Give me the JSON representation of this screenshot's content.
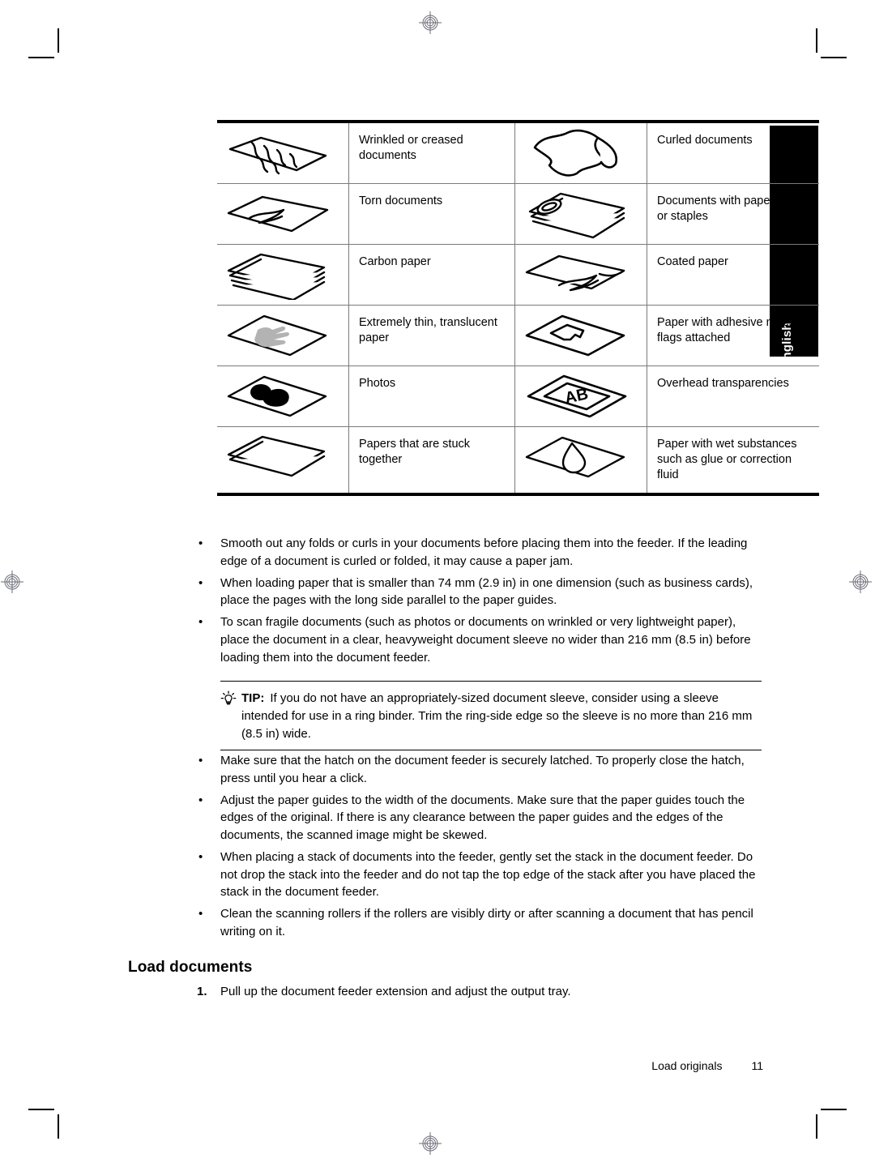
{
  "page": {
    "language_tab": "English",
    "section_heading": "Load documents",
    "footer_title": "Load originals",
    "footer_page_number": "11"
  },
  "media_table": {
    "rows": [
      {
        "left": {
          "icon": "wrinkled-creased-paper-icon",
          "label": "Wrinkled or creased documents"
        },
        "right": {
          "icon": "curled-paper-icon",
          "label": "Curled documents"
        }
      },
      {
        "left": {
          "icon": "torn-paper-icon",
          "label": "Torn documents"
        },
        "right": {
          "icon": "paper-clip-stack-icon",
          "label": "Documents with paper clips or staples"
        }
      },
      {
        "left": {
          "icon": "carbon-paper-stack-icon",
          "label": "Carbon paper"
        },
        "right": {
          "icon": "coated-paper-icon",
          "label": "Coated paper"
        }
      },
      {
        "left": {
          "icon": "translucent-paper-hand-icon",
          "label": "Extremely thin, translucent paper"
        },
        "right": {
          "icon": "adhesive-note-paper-icon",
          "label": "Paper with adhesive notes or flags attached"
        }
      },
      {
        "left": {
          "icon": "photo-paper-icon",
          "label": "Photos"
        },
        "right": {
          "icon": "overhead-transparency-icon",
          "label": "Overhead transparencies"
        }
      },
      {
        "left": {
          "icon": "stuck-together-paper-icon",
          "label": "Papers that are stuck together"
        },
        "right": {
          "icon": "wet-substance-paper-icon",
          "label": "Paper with wet substances such as glue or correction fluid"
        }
      }
    ]
  },
  "bullets_top": {
    "marker": "•",
    "items": [
      "Smooth out any folds or curls in your documents before placing them into the feeder. If the leading edge of a document is curled or folded, it may cause a paper jam.",
      "When loading paper that is smaller than 74 mm (2.9 in) in one dimension (such as business cards), place the pages with the long side parallel to the paper guides.",
      "To scan fragile documents (such as photos or documents on wrinkled or very lightweight paper), place the document in a clear, heavyweight document sleeve no wider than 216 mm (8.5 in) before loading them into the document feeder."
    ]
  },
  "tip": {
    "icon": "lightbulb-tip-icon",
    "label": "TIP:",
    "text": "If you do not have an appropriately-sized document sleeve, consider using a sleeve intended for use in a ring binder. Trim the ring-side edge so the sleeve is no more than 216 mm (8.5 in) wide."
  },
  "bullets_bottom": {
    "marker": "•",
    "items": [
      "Make sure that the hatch on the document feeder is securely latched. To properly close the hatch, press until you hear a click.",
      "Adjust the paper guides to the width of the documents. Make sure that the paper guides touch the edges of the original. If there is any clearance between the paper guides and the edges of the documents, the scanned image might be skewed.",
      "When placing a stack of documents into the feeder, gently set the stack in the document feeder. Do not drop the stack into the feeder and do not tap the top edge of the stack after you have placed the stack in the document feeder.",
      "Clean the scanning rollers if the rollers are visibly dirty or after scanning a document that has pencil writing on it."
    ]
  },
  "steps": [
    {
      "number": "1.",
      "text": "Pull up the document feeder extension and adjust the output tray."
    }
  ],
  "colors": {
    "text": "#000000",
    "page_background": "#ffffff",
    "table_rule": "#7a7a7a",
    "table_heavy_rule": "#000000",
    "language_tab_background": "#000000",
    "language_tab_text": "#ffffff",
    "registration_mark": "#6b6b78"
  }
}
